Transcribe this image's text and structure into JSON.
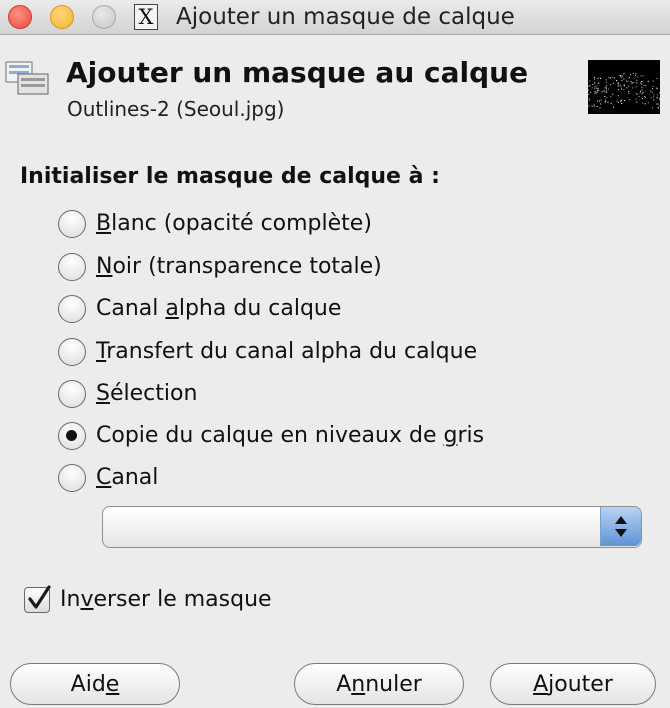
{
  "window": {
    "title": "Ajouter un masque de calque",
    "app_icon": "x11-icon",
    "controls": [
      "close",
      "minimize",
      "maximize"
    ]
  },
  "header": {
    "title": "Ajouter un masque au calque",
    "subtitle": "Outlines-2 (Seoul.jpg)",
    "icon": "layer-mask-icon",
    "thumbnail": "layer-thumbnail"
  },
  "section_label": "Initialiser le masque de calque à :",
  "options": [
    {
      "pre": "",
      "u": "B",
      "post": "lanc (opacité complète)",
      "selected": false
    },
    {
      "pre": "",
      "u": "N",
      "post": "oir (transparence totale)",
      "selected": false
    },
    {
      "pre": "Canal ",
      "u": "a",
      "post": "lpha du calque",
      "selected": false
    },
    {
      "pre": "",
      "u": "T",
      "post": "ransfert du canal alpha du calque",
      "selected": false
    },
    {
      "pre": "",
      "u": "S",
      "post": "élection",
      "selected": false
    },
    {
      "pre": "Copie du calque en niveaux de ",
      "u": "g",
      "post": "ris",
      "selected": true
    },
    {
      "pre": "",
      "u": "C",
      "post": "anal",
      "selected": false
    }
  ],
  "channel_select": {
    "value": ""
  },
  "invert": {
    "pre": "In",
    "u": "v",
    "post": "erser le masque",
    "checked": true
  },
  "buttons": {
    "help": {
      "pre": "Aid",
      "u": "e",
      "post": ""
    },
    "cancel": {
      "pre": "A",
      "u": "n",
      "post": "nuler"
    },
    "add": {
      "pre": "",
      "u": "A",
      "post": "jouter"
    }
  },
  "colors": {
    "accent": "#4a86d4",
    "background": "#ececec"
  }
}
